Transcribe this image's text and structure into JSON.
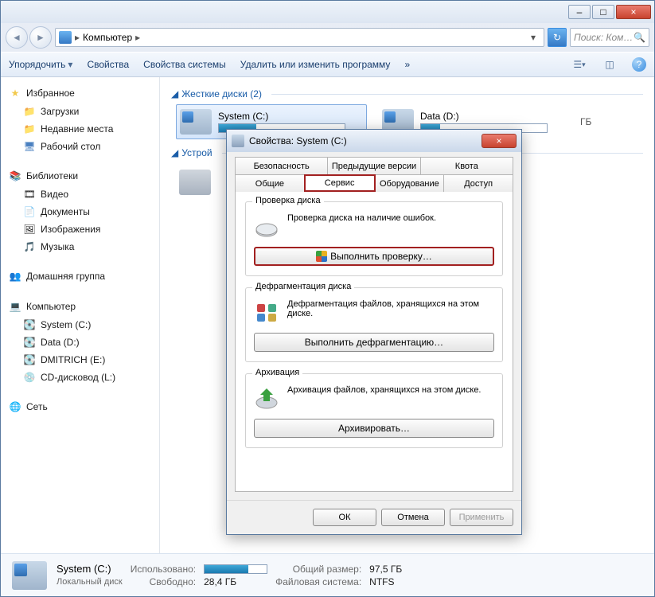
{
  "titlebar": {
    "minimize": "–",
    "maximize": "□",
    "close": "×"
  },
  "breadcrumb": {
    "root_icon": "computer",
    "item1": "Компьютер",
    "sep": "▸",
    "dropdown": "▾"
  },
  "refresh_icon": "↻",
  "search": {
    "placeholder": "Поиск: Ком…",
    "icon": "🔍"
  },
  "toolbar": {
    "organize": "Упорядочить",
    "organize_caret": "▾",
    "properties": "Свойства",
    "system_properties": "Свойства системы",
    "uninstall": "Удалить или изменить программу",
    "overflow": "»",
    "view_caret": "▾",
    "help": "?"
  },
  "sidebar": {
    "favorites": "Избранное",
    "downloads": "Загрузки",
    "recent": "Недавние места",
    "desktop": "Рабочий стол",
    "libraries": "Библиотеки",
    "videos": "Видео",
    "documents": "Документы",
    "pictures": "Изображения",
    "music": "Музыка",
    "homegroup": "Домашняя группа",
    "computer": "Компьютер",
    "drive_c": "System (C:)",
    "drive_d": "Data (D:)",
    "drive_e": "DMITRICH (E:)",
    "drive_cd": "CD-дисковод (L:)",
    "network": "Сеть"
  },
  "main": {
    "hdd_header": "Жесткие диски (2)",
    "drive_c": {
      "label": "System (C:)",
      "fill_pct": 30
    },
    "drive_d": {
      "label": "Data (D:)",
      "suffix": "ГБ",
      "fill_pct": 15
    },
    "devices_header": "Устрой"
  },
  "dialog": {
    "title": "Свойства: System (C:)",
    "close": "×",
    "tabs_row1": {
      "security": "Безопасность",
      "prev_versions": "Предыдущие версии",
      "quota": "Квота"
    },
    "tabs_row2": {
      "general": "Общие",
      "tools": "Сервис",
      "hardware": "Оборудование",
      "sharing": "Доступ"
    },
    "check": {
      "title": "Проверка диска",
      "text": "Проверка диска на наличие ошибок.",
      "button": "Выполнить проверку…"
    },
    "defrag": {
      "title": "Дефрагментация диска",
      "text": "Дефрагментация файлов, хранящихся на этом диске.",
      "button": "Выполнить дефрагментацию…"
    },
    "backup": {
      "title": "Архивация",
      "text": "Архивация файлов, хранящихся на этом диске.",
      "button": "Архивировать…"
    },
    "ok": "ОК",
    "cancel": "Отмена",
    "apply": "Применить"
  },
  "status": {
    "title": "System (C:)",
    "subtitle": "Локальный диск",
    "used_label": "Использовано:",
    "free_label": "Свободно:",
    "free_value": "28,4 ГБ",
    "total_label": "Общий размер:",
    "total_value": "97,5 ГБ",
    "fs_label": "Файловая система:",
    "fs_value": "NTFS",
    "fill_pct": 70
  }
}
